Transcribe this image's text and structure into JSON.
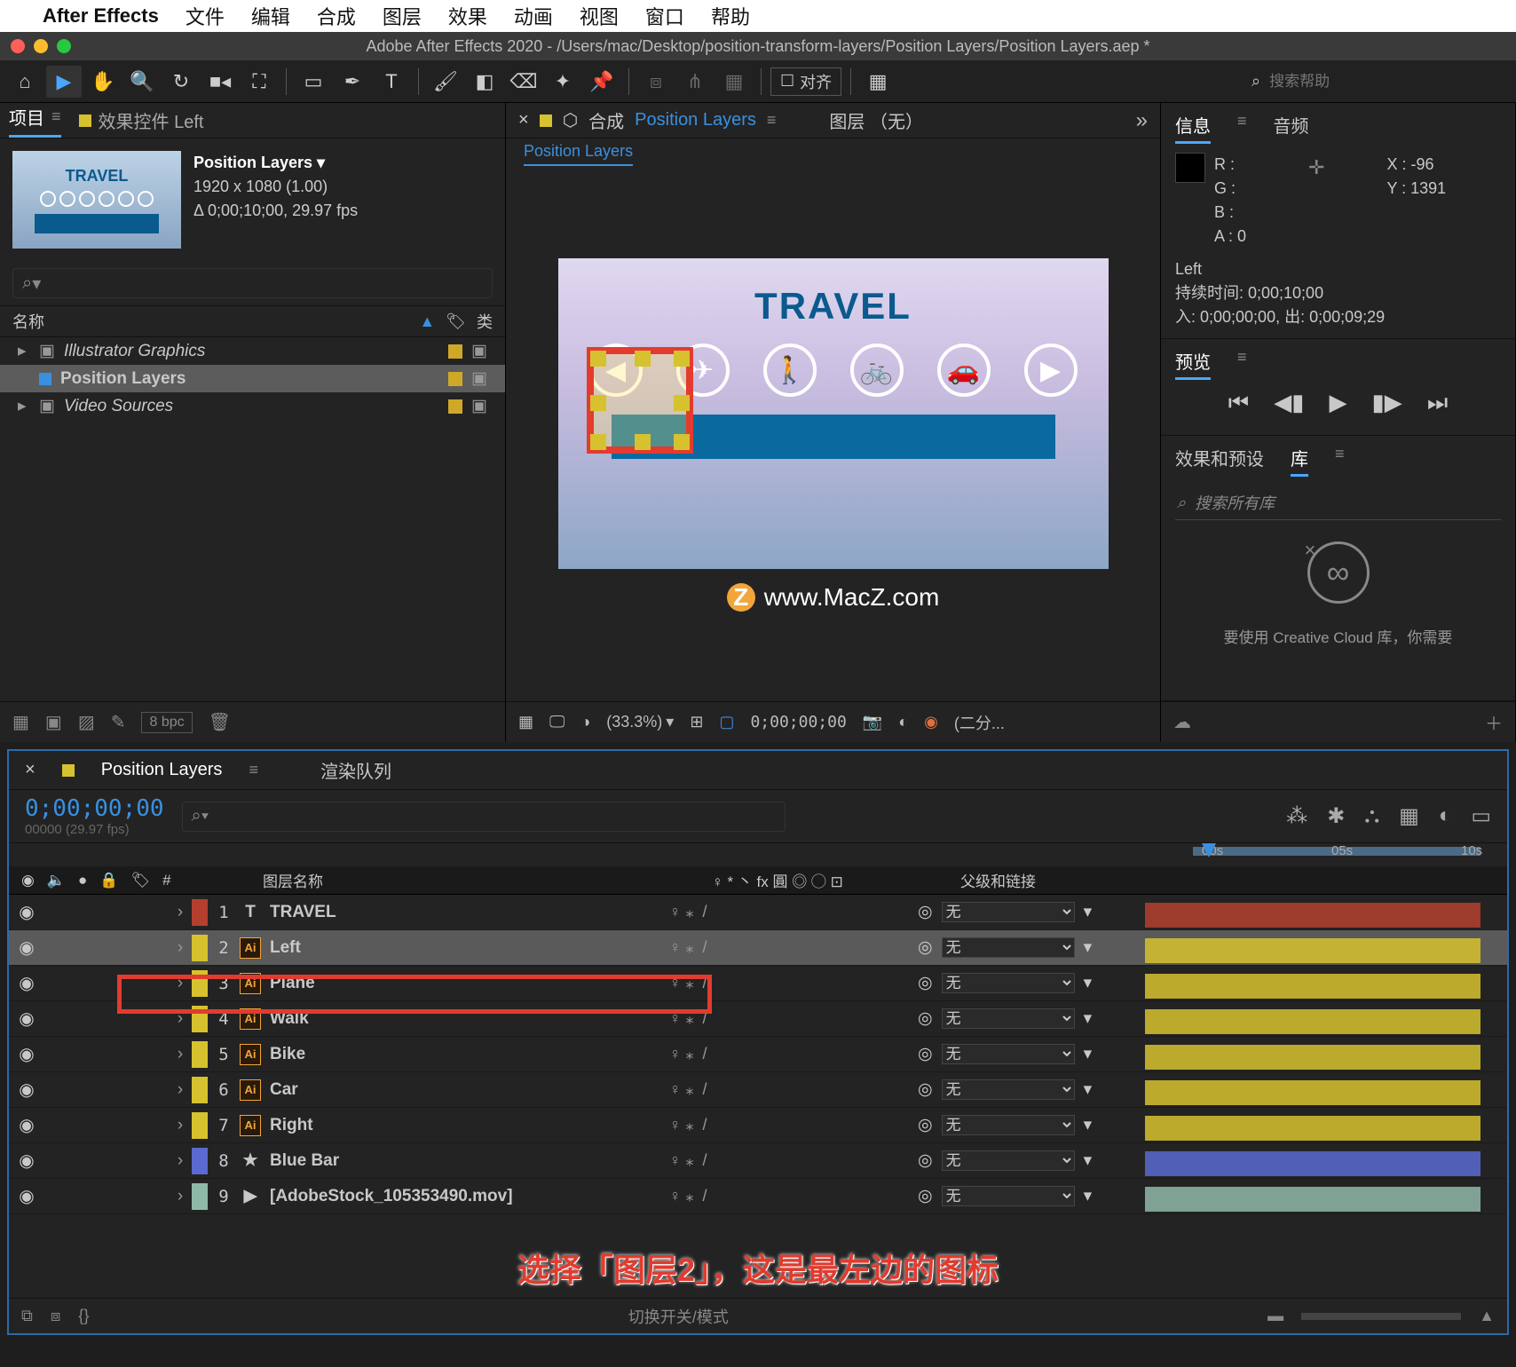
{
  "menubar": {
    "app": "After Effects",
    "items": [
      "文件",
      "编辑",
      "合成",
      "图层",
      "效果",
      "动画",
      "视图",
      "窗口",
      "帮助"
    ]
  },
  "titlebar": "Adobe After Effects 2020 - /Users/mac/Desktop/position-transform-layers/Position Layers/Position Layers.aep *",
  "toolbar": {
    "align": "对齐",
    "search_placeholder": "搜索帮助"
  },
  "project": {
    "tab_project": "项目",
    "tab_effect": "效果控件 Left",
    "comp_name": "Position Layers ▾",
    "comp_res": "1920 x 1080 (1.00)",
    "comp_dur": "Δ 0;00;10;00, 29.97 fps",
    "search": "⌕",
    "col_name": "名称",
    "col_type": "类",
    "items": [
      {
        "label": "Illustrator Graphics",
        "type": "folder"
      },
      {
        "label": "Position Layers",
        "type": "comp",
        "selected": true
      },
      {
        "label": "Video Sources",
        "type": "folder"
      }
    ],
    "bpc": "8 bpc"
  },
  "center": {
    "prefix": "合成",
    "comp_link": "Position Layers",
    "layer_tab": "图层 （无）",
    "mini": "Position Layers",
    "canvas_title": "TRAVEL",
    "watermark": "www.MacZ.com",
    "zoom": "(33.3%)",
    "tc": "0;00;00;00",
    "res": "(二分..."
  },
  "info": {
    "tab_info": "信息",
    "tab_audio": "音频",
    "r": "R :",
    "g": "G :",
    "b": "B :",
    "a": "A :  0",
    "x": "X : -96",
    "y": "Y : 1391",
    "layer": "Left",
    "dur": "持续时间: 0;00;10;00",
    "inout": "入: 0;00;00;00,   出: 0;00;09;29"
  },
  "preview": {
    "tab": "预览"
  },
  "lib": {
    "tab_fx": "效果和预设",
    "tab_lib": "库",
    "search": "搜索所有库",
    "msg": "要使用 Creative Cloud 库，你需要"
  },
  "timeline": {
    "tab_comp": "Position Layers",
    "tab_render": "渲染队列",
    "tc": "0;00;00;00",
    "fps": "00000 (29.97 fps)",
    "ruler": [
      "00s",
      "05s",
      "10s"
    ],
    "col_num": "#",
    "col_name": "图层名称",
    "col_sw": "♀ * 丶 fx 圓 ◎ ◯ ⊡",
    "col_parent": "父级和链接",
    "parent_none": "无",
    "footer_sw": "切换开关/模式",
    "layers": [
      {
        "n": 1,
        "icon": "T",
        "name": "TRAVEL",
        "color": "#b3402e",
        "bar": "#b3402e"
      },
      {
        "n": 2,
        "icon": "Ai",
        "name": "Left",
        "color": "#d6c22e",
        "bar": "#d6c22e",
        "selected": true
      },
      {
        "n": 3,
        "icon": "Ai",
        "name": "Plane",
        "color": "#d6c22e",
        "bar": "#d6c22e"
      },
      {
        "n": 4,
        "icon": "Ai",
        "name": "Walk",
        "color": "#d6c22e",
        "bar": "#d6c22e"
      },
      {
        "n": 5,
        "icon": "Ai",
        "name": "Bike",
        "color": "#d6c22e",
        "bar": "#d6c22e"
      },
      {
        "n": 6,
        "icon": "Ai",
        "name": "Car",
        "color": "#d6c22e",
        "bar": "#d6c22e"
      },
      {
        "n": 7,
        "icon": "Ai",
        "name": "Right",
        "color": "#d6c22e",
        "bar": "#d6c22e"
      },
      {
        "n": 8,
        "icon": "★",
        "name": "Blue Bar",
        "color": "#5a6ad0",
        "bar": "#5a6ad0"
      },
      {
        "n": 9,
        "icon": "▶",
        "name": "[AdobeStock_105353490.mov]",
        "color": "#8fb8a8",
        "bar": "#8fb8a8"
      }
    ]
  },
  "caption": "选择「图层2」，这是最左边的图标"
}
